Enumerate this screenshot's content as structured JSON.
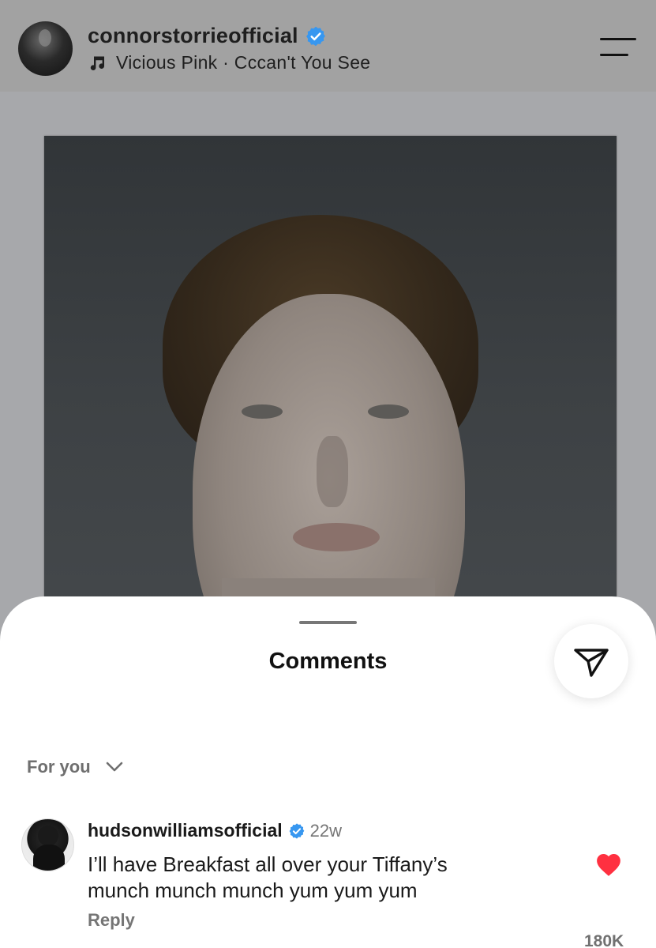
{
  "post": {
    "username": "connorstorrieofficial",
    "verified": true,
    "music": "Vicious Pink · Cccan't You See",
    "menu_icon": "menu-icon"
  },
  "comments_sheet": {
    "title": "Comments",
    "share_icon": "send-icon",
    "sort_label": "For you",
    "comments": [
      {
        "username": "hudsonwilliamsofficial",
        "verified": true,
        "time": "22w",
        "text": "I’ll have Breakfast all over your Tiffany’s\nmunch munch munch yum yum yum",
        "reply_label": "Reply",
        "likes": "180K",
        "liked": true
      }
    ]
  },
  "colors": {
    "verified_blue": "#3797f0",
    "like_red": "#ff3040"
  }
}
